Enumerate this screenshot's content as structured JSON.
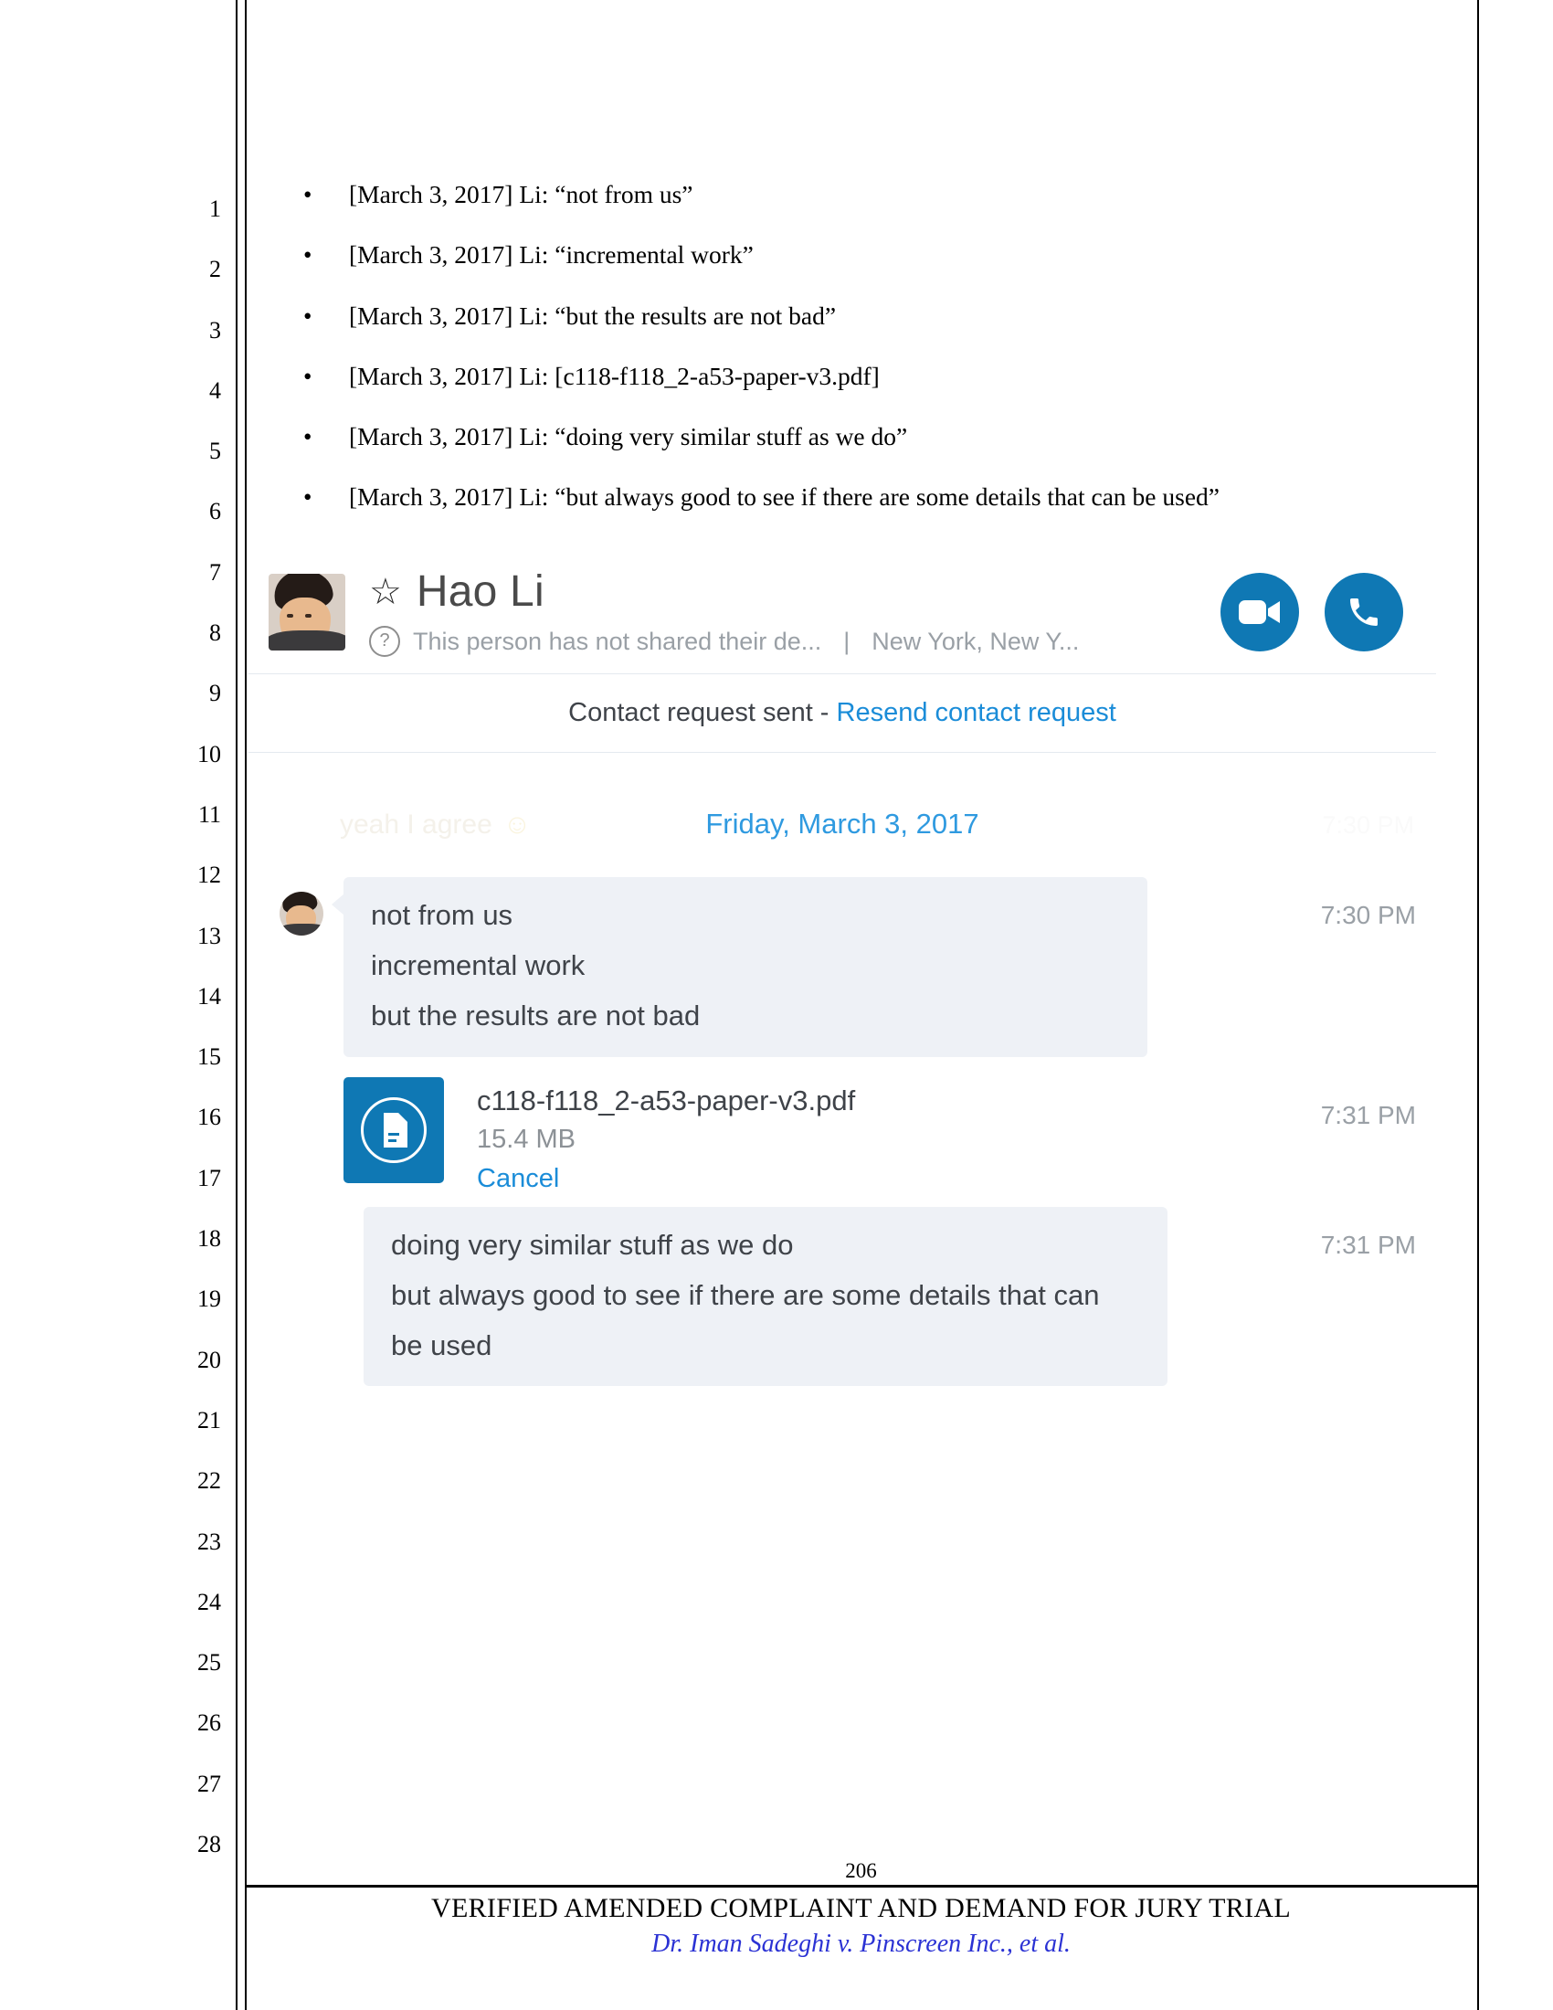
{
  "document": {
    "line_numbers": [
      "1",
      "2",
      "3",
      "4",
      "5",
      "6",
      "7",
      "8",
      "9",
      "10",
      "11",
      "12",
      "13",
      "14",
      "15",
      "16",
      "17",
      "18",
      "19",
      "20",
      "21",
      "22",
      "23",
      "24",
      "25",
      "26",
      "27",
      "28"
    ],
    "bullets": [
      "[March 3, 2017] Li: “not from us”",
      "[March 3, 2017] Li: “incremental work”",
      "[March 3, 2017] Li: “but the results are not bad”",
      "[March 3, 2017] Li: [c118-f118_2-a53-paper-v3.pdf]",
      "[March 3, 2017] Li: “doing very similar stuff as we do”",
      "[March 3, 2017] Li: “but always good to see if there are some details that can be used”"
    ],
    "bullet_marker": "•",
    "footer": {
      "page_number": "206",
      "title": "VERIFIED AMENDED COMPLAINT AND DEMAND FOR JURY TRIAL",
      "case_caption": "Dr. Iman Sadeghi v. Pinscreen Inc., et al."
    }
  },
  "skype": {
    "header": {
      "favorite_icon": "☆",
      "contact_name": "Hao Li",
      "status_icon": "?",
      "mood_message": "This person has not shared their de...",
      "separator": "|",
      "location": "New York, New Y...",
      "video_call_label": "video-call",
      "audio_call_label": "audio-call",
      "accent_color": "#0f78b4"
    },
    "contact_request": {
      "text": "Contact request sent - ",
      "link": "Resend contact request",
      "link_color": "#1a8cd8"
    },
    "ghost_message": {
      "text": "yeah I agree",
      "emoji": "☺",
      "time": "7:30 PM"
    },
    "date_divider": "Friday, March 3, 2017",
    "messages": [
      {
        "sender": "Hao Li",
        "lines": [
          "not from us",
          "incremental work",
          "but the results are not bad"
        ],
        "time": "7:30 PM"
      },
      {
        "sender": "Hao Li",
        "lines": [
          "doing very similar stuff as we do",
          "but always good to see if there are some details that can",
          "be used"
        ],
        "time": "7:31 PM"
      }
    ],
    "attachment": {
      "file_name": "c118-f118_2-a53-paper-v3.pdf",
      "file_size": "15.4 MB",
      "cancel_label": "Cancel",
      "time": "7:31 PM",
      "icon": "document-icon"
    }
  }
}
